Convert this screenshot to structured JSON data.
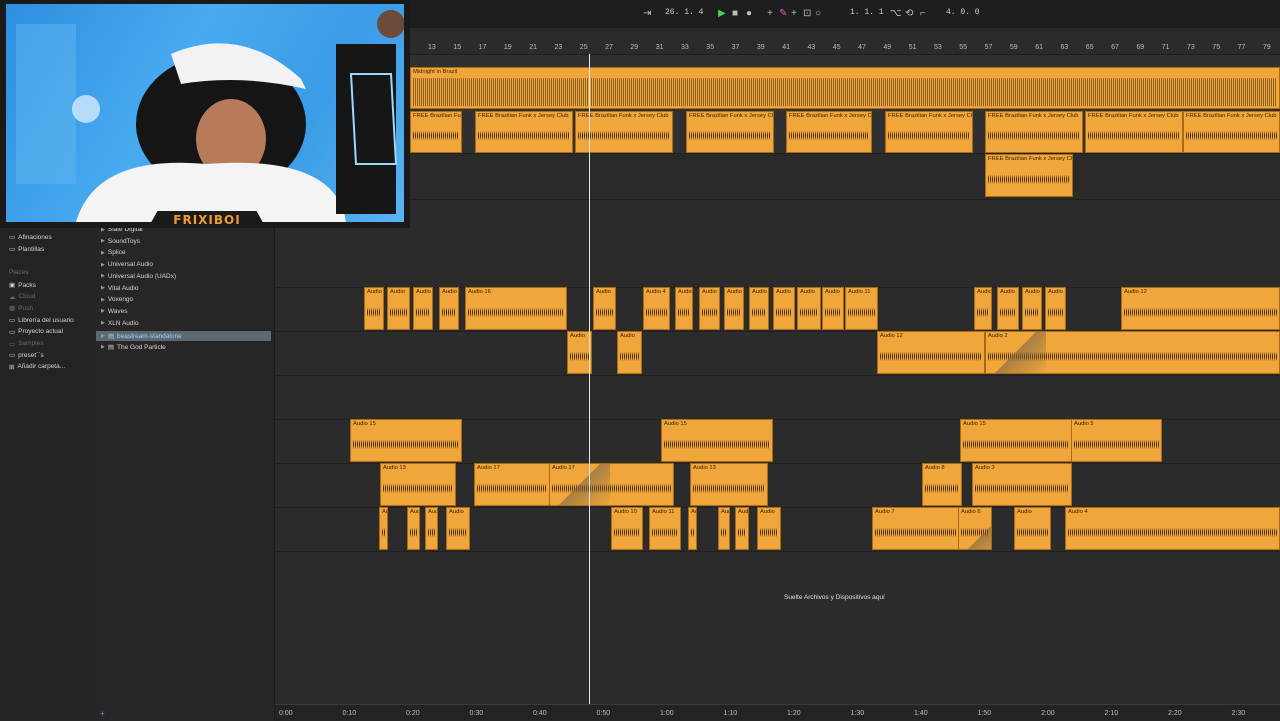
{
  "transport": {
    "position": "26. 1. 4",
    "loop_start": "1. 1. 1",
    "loop_length": "4. 0. 0"
  },
  "ruler": {
    "bars": [
      "13",
      "15",
      "17",
      "19",
      "21",
      "23",
      "25",
      "27",
      "29",
      "31",
      "33",
      "35",
      "37",
      "39",
      "41",
      "43",
      "45",
      "47",
      "49",
      "51",
      "53",
      "55",
      "57",
      "59",
      "61",
      "63",
      "65",
      "67",
      "69",
      "71",
      "73",
      "75",
      "77",
      "79"
    ]
  },
  "time_ruler": [
    "0:00",
    "0:10",
    "0:20",
    "0:30",
    "0:40",
    "0:50",
    "1:00",
    "1:10",
    "1:20",
    "1:30",
    "1:40",
    "1:50",
    "2:00",
    "2:10",
    "2:20",
    "2:30"
  ],
  "browser": {
    "collections": [
      {
        "label": "Afinaciones",
        "icon": "folder-icon"
      },
      {
        "label": "Plantillas",
        "icon": "folder-icon"
      }
    ],
    "places_header": "Places",
    "places": [
      {
        "label": "Packs",
        "icon": "packs-icon",
        "dim": false
      },
      {
        "label": "Cloud",
        "icon": "cloud-icon",
        "dim": true
      },
      {
        "label": "Push",
        "icon": "push-icon",
        "dim": true
      },
      {
        "label": "Librería del usuario",
        "icon": "folder-icon",
        "dim": false
      },
      {
        "label": "Proyecto actual",
        "icon": "folder-icon",
        "dim": false
      },
      {
        "label": "Samples",
        "icon": "folder-icon",
        "dim": true
      },
      {
        "label": "preset´´s",
        "icon": "folder-icon",
        "dim": false
      },
      {
        "label": "Añadir carpeta...",
        "icon": "add-folder-icon",
        "dim": false
      }
    ],
    "plugins": [
      {
        "label": "Slate Digital"
      },
      {
        "label": "SoundToys"
      },
      {
        "label": "Splice"
      },
      {
        "label": "Universal Audio"
      },
      {
        "label": "Universal Audio (UADx)"
      },
      {
        "label": "Vital Audio"
      },
      {
        "label": "Voxengo"
      },
      {
        "label": "Waves"
      },
      {
        "label": "XLN Audio"
      },
      {
        "label": "beastream-standalone"
      },
      {
        "label": "The God Particle"
      }
    ]
  },
  "webcam": {
    "label": "FRIXIBOI"
  },
  "arrangement": {
    "drop_hint": "Suelte Archivos y Dispositivos aquí",
    "clips": {
      "midnight": "Midnight in Brazil",
      "brazilian": "FREE Brazilian Funk x Jersey Club",
      "audio": "Audio",
      "audio16": "Audio 16",
      "audio4": "Audio 4",
      "audio11": "Audio 11",
      "audio12": "Audio 12",
      "audio2": "Audio 2",
      "audio15": "Audio 15",
      "audio5": "Audio 5",
      "audio13": "Audio 13",
      "audio17": "Audio 17",
      "audio8": "Audio 8",
      "audio3": "Audio 3",
      "audio10": "Audio 10",
      "audio7": "Audio 7",
      "audio6": "Audio 6"
    }
  },
  "colors": {
    "clip": "#f0a63a",
    "accent": "#f39a2e",
    "play": "#3fd15a"
  }
}
